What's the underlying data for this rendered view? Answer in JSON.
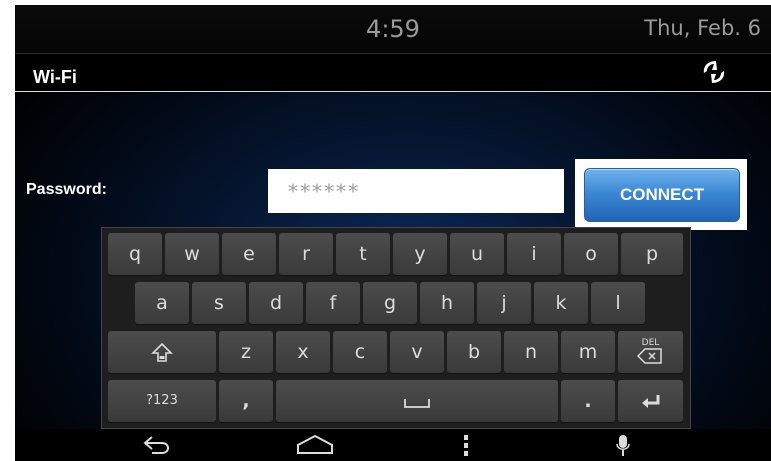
{
  "status": {
    "time": "4:59",
    "date": "Thu, Feb. 6"
  },
  "header": {
    "title": "Wi-Fi",
    "logo_icon": "nissan-logo-icon"
  },
  "form": {
    "password_label": "Password:",
    "password_value": "******",
    "connect_label": "CONNECT"
  },
  "keyboard": {
    "row1": [
      "q",
      "w",
      "e",
      "r",
      "t",
      "y",
      "u",
      "i",
      "o",
      "p"
    ],
    "row2": [
      "a",
      "s",
      "d",
      "f",
      "g",
      "h",
      "j",
      "k",
      "l"
    ],
    "row3": [
      "z",
      "x",
      "c",
      "v",
      "b",
      "n",
      "m"
    ],
    "shift_icon": "shift-icon",
    "delete_label": "DEL",
    "symbols_label": "?123",
    "comma": ",",
    "period": ".",
    "space_icon": "space-icon",
    "enter_icon": "enter-icon"
  },
  "nav": {
    "icons": [
      "back-icon",
      "home-icon",
      "menu-icon",
      "mic-icon"
    ]
  },
  "colors": {
    "accent": "#3c88d4",
    "background": "#061937"
  }
}
